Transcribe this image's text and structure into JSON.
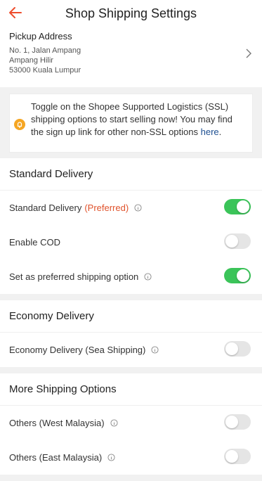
{
  "header": {
    "title": "Shop Shipping Settings",
    "back_icon": "arrow-left-icon"
  },
  "address": {
    "label": "Pickup Address",
    "line1": "No. 1, Jalan Ampang",
    "line2": "Ampang Hilir",
    "line3": "53000 Kuala Lumpur"
  },
  "notice": {
    "text": "Toggle on the Shopee Supported Logistics (SSL) shipping options to start selling now! You may find the sign up link for other non-SSL options ",
    "link": "here",
    "end": "."
  },
  "standard": {
    "title": "Standard Delivery",
    "rows": [
      {
        "label": "Standard Delivery",
        "tag": "(Preferred)",
        "info": true,
        "on": true
      },
      {
        "label": "Enable COD",
        "on": false
      },
      {
        "label": "Set as preferred shipping option",
        "info": true,
        "on": true
      }
    ]
  },
  "economy": {
    "title": "Economy Delivery",
    "rows": [
      {
        "label": "Economy Delivery (Sea Shipping)",
        "info": true,
        "on": false
      }
    ]
  },
  "more": {
    "title": "More Shipping Options",
    "rows": [
      {
        "label": "Others (West Malaysia)",
        "info": true,
        "on": false
      },
      {
        "label": "Others (East Malaysia)",
        "info": true,
        "on": false
      }
    ]
  },
  "colors": {
    "accent": "#ee4d2d",
    "toggle_on": "#3bc459",
    "link": "#1d4f91"
  }
}
